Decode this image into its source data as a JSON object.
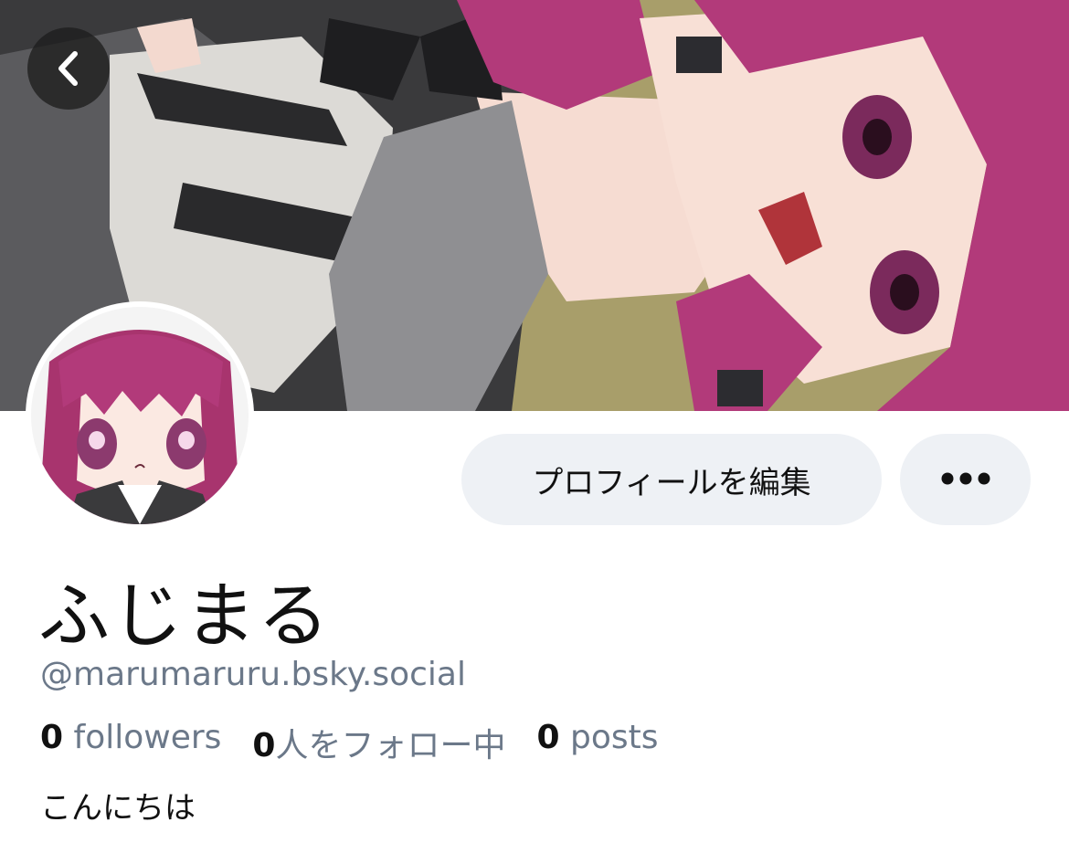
{
  "header": {
    "back_icon": "chevron-left-icon"
  },
  "actions": {
    "edit_profile_label": "プロフィールを編集",
    "more_icon": "ellipsis-icon"
  },
  "profile": {
    "display_name": "ふじまる",
    "handle": "@marumaruru.bsky.social",
    "bio": "こんにちは"
  },
  "stats": {
    "followers_count": "0",
    "followers_label": "followers",
    "following_count": "0",
    "following_label": "人をフォロー中",
    "posts_count": "0",
    "posts_label": "posts"
  },
  "colors": {
    "accent_hair": "#b23a7a",
    "button_bg": "#eef1f5",
    "muted_text": "#6b7889"
  }
}
